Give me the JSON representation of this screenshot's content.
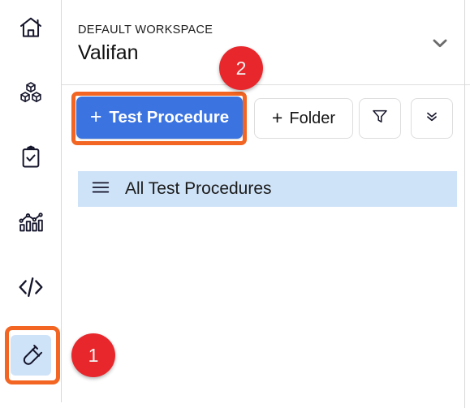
{
  "sidebar": {
    "items": [
      {
        "name": "home",
        "icon": "home-icon",
        "active": false
      },
      {
        "name": "assets",
        "icon": "cubes-icon",
        "active": false
      },
      {
        "name": "tasks",
        "icon": "clipboard-check-icon",
        "active": false
      },
      {
        "name": "analytics",
        "icon": "bar-chart-icon",
        "active": false
      },
      {
        "name": "code",
        "icon": "code-icon",
        "active": false
      },
      {
        "name": "test-procedures",
        "icon": "test-tube-icon",
        "active": true
      }
    ]
  },
  "header": {
    "workspace_label": "DEFAULT WORKSPACE",
    "workspace_name": "Valifan",
    "dropdown_icon": "chevron-down-icon"
  },
  "toolbar": {
    "primary_button": {
      "plus": "+",
      "label": "Test Procedure"
    },
    "folder_button": {
      "plus": "+",
      "label": "Folder"
    },
    "filter_button": {
      "icon": "filter-icon"
    },
    "more_button": {
      "icon": "double-chevron-down-icon"
    }
  },
  "list": {
    "rows": [
      {
        "icon": "list-lines-icon",
        "label": "All Test Procedures"
      }
    ]
  },
  "annotations": {
    "step1": "1",
    "step2": "2"
  },
  "colors": {
    "primary_blue": "#3b73e0",
    "highlight_orange": "#f26522",
    "badge_red": "#e8272c",
    "row_blue": "#cfe3f8",
    "active_rail_blue": "#cfe3f8"
  }
}
